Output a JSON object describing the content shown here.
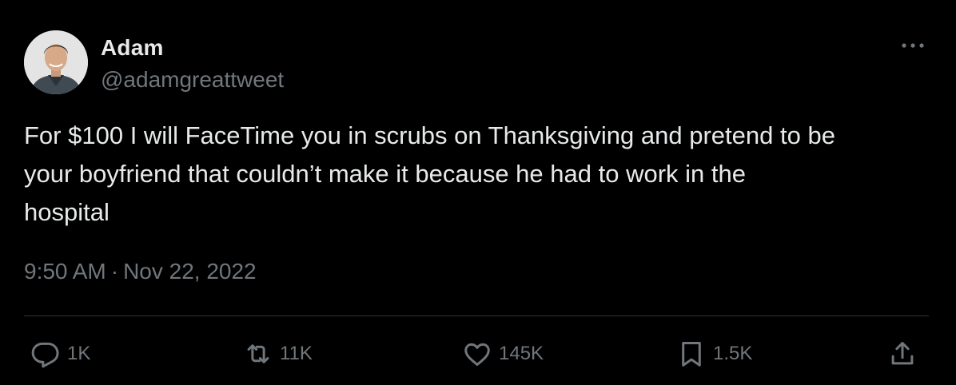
{
  "author": {
    "display_name": "Adam",
    "handle": "@adamgreattweet"
  },
  "tweet": {
    "text": "For $100 I will FaceTime you in scrubs on Thanksgiving and pretend to be\nyour boyfriend that couldn’t make it because he had to work in the\nhospital",
    "time": "9:50 AM",
    "separator": "·",
    "date": "Nov 22, 2022"
  },
  "actions": {
    "replies": "1K",
    "retweets": "11K",
    "likes": "145K",
    "bookmarks": "1.5K"
  },
  "icons": {
    "more": "more-horizontal-icon",
    "reply": "reply-icon",
    "retweet": "retweet-icon",
    "like": "heart-icon",
    "bookmark": "bookmark-icon",
    "share": "share-icon"
  },
  "colors": {
    "background": "#000000",
    "text_primary": "#e7e9ea",
    "text_secondary": "#71767b",
    "divider": "#2f3336"
  }
}
